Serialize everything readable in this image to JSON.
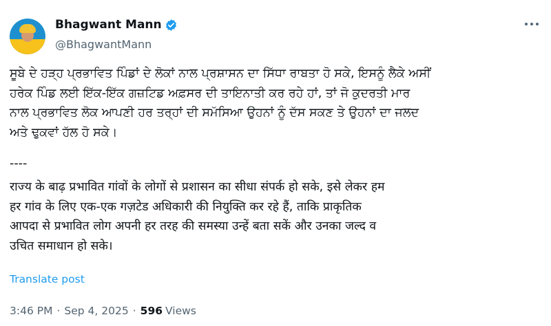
{
  "author": {
    "display_name": "Bhagwant Mann",
    "handle": "@BhagwantMann",
    "avatar_icon": "profile-photo",
    "verified_icon": "verified-badge-icon",
    "verified_color": "#1d9bf0"
  },
  "post": {
    "punjabi_text": "ਸੂਬੇ ਦੇ ਹੜ੍ਹ ਪ੍ਰਭਾਵਿਤ ਪਿੰਡਾਂ ਦੇ ਲੋਕਾਂ ਨਾਲ ਪ੍ਰਸ਼ਾਸਨ ਦਾ ਸਿੱਧਾ ਰਾਬਤਾ ਹੋ ਸਕੇ, ਇਸਨੂੰ ਲੈਕੇ ਅਸੀਂ\nਹਰੇਕ ਪਿੰਡ ਲਈ ਇੱਕ-ਇੱਕ ਗਜ਼ਟਿਡ ਅਫ਼ਸਰ ਦੀ ਤਾਇਨਾਤੀ ਕਰ ਰਹੇ ਹਾਂ, ਤਾਂ ਜੋ ਕੁਦਰਤੀ ਮਾਰ\nਨਾਲ ਪ੍ਰਭਾਵਿਤ ਲੋਕ ਆਪਣੀ ਹਰ ਤਰ੍ਹਾਂ ਦੀ ਸਮੱਸਿਆ ਉਹਨਾਂ ਨੂੰ ਦੱਸ ਸਕਣ ਤੇ ਉਹਨਾਂ ਦਾ ਜਲਦ\nਅਤੇ ਢੁਕਵਾਂ ਹੱਲ ਹੋ ਸਕੇ।",
    "separator": "----",
    "hindi_text": "राज्य के बाढ़ प्रभावित गांवों के लोगों से प्रशासन का सीधा संपर्क हो सके, इसे लेकर हम\nहर गांव के लिए एक-एक गज़टेड अधिकारी की नियुक्ति कर रहे हैं, ताकि प्राकृतिक\nआपदा से प्रभावित लोग अपनी हर तरह की समस्या उन्हें बता सकें और उनका जल्द व\nउचित समाधान हो सके।",
    "translate_label": "Translate post",
    "link_color": "#1d9bf0"
  },
  "meta": {
    "time": "3:46 PM",
    "separator": "·",
    "date": "Sep 4, 2025",
    "views_count": "596",
    "views_label": "Views"
  },
  "menu": {
    "more_icon": "more-options-icon"
  }
}
